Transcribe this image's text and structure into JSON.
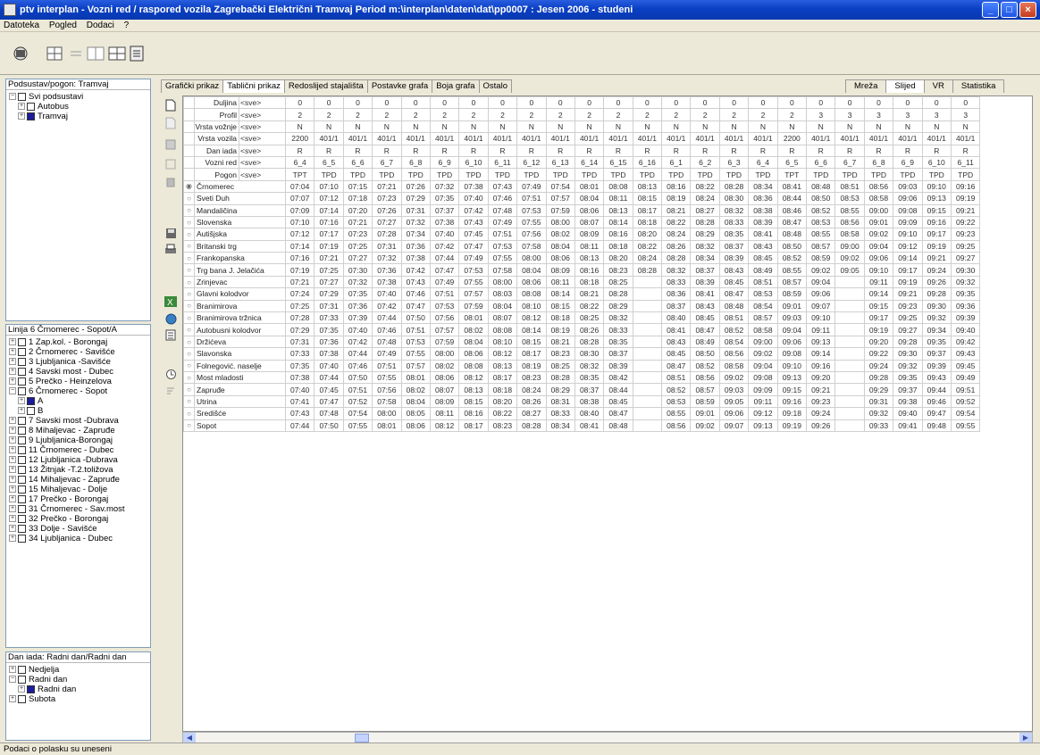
{
  "window": {
    "title": "ptv interplan - Vozni red / raspored vozila  Zagrebački Električni Tramvaj Period m:\\interplan\\daten\\dat\\pp0007 : Jesen 2006 - studeni",
    "buttons": [
      "_",
      "□",
      "×"
    ]
  },
  "menu": [
    "Datoteka",
    "Pogled",
    "Dodaci",
    "?"
  ],
  "panels": {
    "top": {
      "header": "Podsustav/pogon: Tramvaj",
      "nodes": [
        {
          "ex": "−",
          "label": "Svi podsustavi",
          "indent": 0,
          "on": false
        },
        {
          "ex": "+",
          "label": "Autobus",
          "indent": 1,
          "on": false
        },
        {
          "ex": "+",
          "label": "Tramvaj",
          "indent": 1,
          "on": true
        }
      ]
    },
    "mid": {
      "header": "Linija 6 Črnomerec - Sopot/A",
      "nodes": [
        {
          "ex": "+",
          "label": "1 Zap.kol. - Borongaj",
          "indent": 0,
          "on": false
        },
        {
          "ex": "+",
          "label": "2 Črnomerec - Savišće",
          "indent": 0,
          "on": false
        },
        {
          "ex": "+",
          "label": "3 Ljubljanica -Savišće",
          "indent": 0,
          "on": false
        },
        {
          "ex": "+",
          "label": "4 Savski most - Dubec",
          "indent": 0,
          "on": false
        },
        {
          "ex": "+",
          "label": "5 Prečko - Heinzelova",
          "indent": 0,
          "on": false
        },
        {
          "ex": "−",
          "label": "6 Črnomerec - Sopot",
          "indent": 0,
          "on": false
        },
        {
          "ex": "+",
          "label": "A",
          "indent": 1,
          "on": true
        },
        {
          "ex": "+",
          "label": "B",
          "indent": 1,
          "on": false
        },
        {
          "ex": "+",
          "label": "7 Savski most -Dubrava",
          "indent": 0,
          "on": false
        },
        {
          "ex": "+",
          "label": "8 Mihaljevac - Zapruđe",
          "indent": 0,
          "on": false
        },
        {
          "ex": "+",
          "label": "9 Ljubljanica-Borongaj",
          "indent": 0,
          "on": false
        },
        {
          "ex": "+",
          "label": "11 Črnomerec - Dubec",
          "indent": 0,
          "on": false
        },
        {
          "ex": "+",
          "label": "12 Ljubljanica -Dubrava",
          "indent": 0,
          "on": false
        },
        {
          "ex": "+",
          "label": "13 Žitnjak -T.2.toližova",
          "indent": 0,
          "on": false
        },
        {
          "ex": "+",
          "label": "14 Mihaljevac - Zapruđe",
          "indent": 0,
          "on": false
        },
        {
          "ex": "+",
          "label": "15 Mihaljevac - Dolje",
          "indent": 0,
          "on": false
        },
        {
          "ex": "+",
          "label": "17 Prečko - Borongaj",
          "indent": 0,
          "on": false
        },
        {
          "ex": "+",
          "label": "31 Črnomerec - Sav.most",
          "indent": 0,
          "on": false
        },
        {
          "ex": "+",
          "label": "32 Prečko - Borongaj",
          "indent": 0,
          "on": false
        },
        {
          "ex": "+",
          "label": "33 Dolje - Savišće",
          "indent": 0,
          "on": false
        },
        {
          "ex": "+",
          "label": "34 Ljubljanica - Dubec",
          "indent": 0,
          "on": false
        }
      ]
    },
    "bottom": {
      "header": "Dan iada: Radni dan/Radni dan",
      "nodes": [
        {
          "ex": "+",
          "label": "Nedjelja",
          "indent": 0,
          "on": false
        },
        {
          "ex": "−",
          "label": "Radni dan",
          "indent": 0,
          "on": false
        },
        {
          "ex": "+",
          "label": "Radni dan",
          "indent": 1,
          "on": true
        },
        {
          "ex": "+",
          "label": "Subota",
          "indent": 0,
          "on": false
        }
      ]
    }
  },
  "tabs": [
    "Grafički prikaz",
    "Tablični prikaz",
    "Redoslijed stajališta",
    "Postavke grafa",
    "Boja grafa",
    "Ostalo"
  ],
  "active_tab": 1,
  "right_tabs": [
    "Mreža",
    "Slijed",
    "VR",
    "Statistika"
  ],
  "right_active": 1,
  "grid": {
    "header_rows": [
      {
        "label": "Duljina",
        "sel": "<sve>",
        "values": [
          "0",
          "0",
          "0",
          "0",
          "0",
          "0",
          "0",
          "0",
          "0",
          "0",
          "0",
          "0",
          "0",
          "0",
          "0",
          "0",
          "0",
          "0",
          "0",
          "0",
          "0",
          "0",
          "0",
          "0"
        ]
      },
      {
        "label": "Profil",
        "sel": "<sve>",
        "values": [
          "2",
          "2",
          "2",
          "2",
          "2",
          "2",
          "2",
          "2",
          "2",
          "2",
          "2",
          "2",
          "2",
          "2",
          "2",
          "2",
          "2",
          "2",
          "3",
          "3",
          "3",
          "3",
          "3",
          "3"
        ]
      },
      {
        "label": "Vrsta vožnje",
        "sel": "<sve>",
        "values": [
          "N",
          "N",
          "N",
          "N",
          "N",
          "N",
          "N",
          "N",
          "N",
          "N",
          "N",
          "N",
          "N",
          "N",
          "N",
          "N",
          "N",
          "N",
          "N",
          "N",
          "N",
          "N",
          "N",
          "N"
        ]
      },
      {
        "label": "Vrsta vozila",
        "sel": "<sve>",
        "values": [
          "2200",
          "401/1",
          "401/1",
          "401/1",
          "401/1",
          "401/1",
          "401/1",
          "401/1",
          "401/1",
          "401/1",
          "401/1",
          "401/1",
          "401/1",
          "401/1",
          "401/1",
          "401/1",
          "401/1",
          "2200",
          "401/1",
          "401/1",
          "401/1",
          "401/1",
          "401/1",
          "401/1"
        ]
      },
      {
        "label": "Dan iada",
        "sel": "<sve>",
        "values": [
          "R",
          "R",
          "R",
          "R",
          "R",
          "R",
          "R",
          "R",
          "R",
          "R",
          "R",
          "R",
          "R",
          "R",
          "R",
          "R",
          "R",
          "R",
          "R",
          "R",
          "R",
          "R",
          "R",
          "R"
        ]
      },
      {
        "label": "Vozni red",
        "sel": "<sve>",
        "values": [
          "6_4",
          "6_5",
          "6_6",
          "6_7",
          "6_8",
          "6_9",
          "6_10",
          "6_11",
          "6_12",
          "6_13",
          "6_14",
          "6_15",
          "6_16",
          "6_1",
          "6_2",
          "6_3",
          "6_4",
          "6_5",
          "6_6",
          "6_7",
          "6_8",
          "6_9",
          "6_10",
          "6_11"
        ]
      },
      {
        "label": "Pogon",
        "sel": "<sve>",
        "values": [
          "TPT",
          "TPD",
          "TPD",
          "TPD",
          "TPD",
          "TPD",
          "TPD",
          "TPD",
          "TPD",
          "TPD",
          "TPD",
          "TPD",
          "TPD",
          "TPD",
          "TPD",
          "TPD",
          "TPD",
          "TPT",
          "TPD",
          "TPD",
          "TPD",
          "TPD",
          "TPD",
          "TPD"
        ]
      }
    ],
    "stops": [
      {
        "name": "Črnomerec",
        "sel": true,
        "times": [
          "07:04",
          "07:10",
          "07:15",
          "07:21",
          "07:26",
          "07:32",
          "07:38",
          "07:43",
          "07:49",
          "07:54",
          "08:01",
          "08:08",
          "08:13",
          "08:16",
          "08:22",
          "08:28",
          "08:34",
          "08:41",
          "08:48",
          "08:51",
          "08:56",
          "09:03",
          "09:10",
          "09:16"
        ]
      },
      {
        "name": "Sveti Duh",
        "sel": false,
        "times": [
          "07:07",
          "07:12",
          "07:18",
          "07:23",
          "07:29",
          "07:35",
          "07:40",
          "07:46",
          "07:51",
          "07:57",
          "08:04",
          "08:11",
          "08:15",
          "08:19",
          "08:24",
          "08:30",
          "08:36",
          "08:44",
          "08:50",
          "08:53",
          "08:58",
          "09:06",
          "09:13",
          "09:19"
        ]
      },
      {
        "name": "Mandaličina",
        "sel": false,
        "times": [
          "07:09",
          "07:14",
          "07:20",
          "07:26",
          "07:31",
          "07:37",
          "07:42",
          "07:48",
          "07:53",
          "07:59",
          "08:06",
          "08:13",
          "08:17",
          "08:21",
          "08:27",
          "08:32",
          "08:38",
          "08:46",
          "08:52",
          "08:55",
          "09:00",
          "09:08",
          "09:15",
          "09:21"
        ]
      },
      {
        "name": "Slovenska",
        "sel": false,
        "times": [
          "07:10",
          "07:16",
          "07:21",
          "07:27",
          "07:32",
          "07:38",
          "07:43",
          "07:49",
          "07:55",
          "08:00",
          "08:07",
          "08:14",
          "08:18",
          "08:22",
          "08:28",
          "08:33",
          "08:39",
          "08:47",
          "08:53",
          "08:56",
          "09:01",
          "09:09",
          "09:16",
          "09:22"
        ]
      },
      {
        "name": "Autišjska",
        "sel": false,
        "times": [
          "07:12",
          "07:17",
          "07:23",
          "07:28",
          "07:34",
          "07:40",
          "07:45",
          "07:51",
          "07:56",
          "08:02",
          "08:09",
          "08:16",
          "08:20",
          "08:24",
          "08:29",
          "08:35",
          "08:41",
          "08:48",
          "08:55",
          "08:58",
          "09:02",
          "09:10",
          "09:17",
          "09:23"
        ]
      },
      {
        "name": "Britanski trg",
        "sel": false,
        "times": [
          "07:14",
          "07:19",
          "07:25",
          "07:31",
          "07:36",
          "07:42",
          "07:47",
          "07:53",
          "07:58",
          "08:04",
          "08:11",
          "08:18",
          "08:22",
          "08:26",
          "08:32",
          "08:37",
          "08:43",
          "08:50",
          "08:57",
          "09:00",
          "09:04",
          "09:12",
          "09:19",
          "09:25"
        ]
      },
      {
        "name": "Frankopanska",
        "sel": false,
        "times": [
          "07:16",
          "07:21",
          "07:27",
          "07:32",
          "07:38",
          "07:44",
          "07:49",
          "07:55",
          "08:00",
          "08:06",
          "08:13",
          "08:20",
          "08:24",
          "08:28",
          "08:34",
          "08:39",
          "08:45",
          "08:52",
          "08:59",
          "09:02",
          "09:06",
          "09:14",
          "09:21",
          "09:27"
        ]
      },
      {
        "name": "Trg bana J. Jelačića",
        "sel": false,
        "times": [
          "07:19",
          "07:25",
          "07:30",
          "07:36",
          "07:42",
          "07:47",
          "07:53",
          "07:58",
          "08:04",
          "08:09",
          "08:16",
          "08:23",
          "08:28",
          "08:32",
          "08:37",
          "08:43",
          "08:49",
          "08:55",
          "09:02",
          "09:05",
          "09:10",
          "09:17",
          "09:24",
          "09:30"
        ]
      },
      {
        "name": "Zrinjevac",
        "sel": false,
        "times": [
          "07:21",
          "07:27",
          "07:32",
          "07:38",
          "07:43",
          "07:49",
          "07:55",
          "08:00",
          "08:06",
          "08:11",
          "08:18",
          "08:25",
          "",
          "08:33",
          "08:39",
          "08:45",
          "08:51",
          "08:57",
          "09:04",
          "",
          "09:11",
          "09:19",
          "09:26",
          "09:32"
        ]
      },
      {
        "name": "Glavni kolodvor",
        "sel": false,
        "times": [
          "07:24",
          "07:29",
          "07:35",
          "07:40",
          "07:46",
          "07:51",
          "07:57",
          "08:03",
          "08:08",
          "08:14",
          "08:21",
          "08:28",
          "",
          "08:36",
          "08:41",
          "08:47",
          "08:53",
          "08:59",
          "09:06",
          "",
          "09:14",
          "09:21",
          "09:28",
          "09:35"
        ]
      },
      {
        "name": "Branimirova",
        "sel": false,
        "times": [
          "07:25",
          "07:31",
          "07:36",
          "07:42",
          "07:47",
          "07:53",
          "07:59",
          "08:04",
          "08:10",
          "08:15",
          "08:22",
          "08:29",
          "",
          "08:37",
          "08:43",
          "08:48",
          "08:54",
          "09:01",
          "09:07",
          "",
          "09:15",
          "09:23",
          "09:30",
          "09:36"
        ]
      },
      {
        "name": "Branimirova tržnica",
        "sel": false,
        "times": [
          "07:28",
          "07:33",
          "07:39",
          "07:44",
          "07:50",
          "07:56",
          "08:01",
          "08:07",
          "08:12",
          "08:18",
          "08:25",
          "08:32",
          "",
          "08:40",
          "08:45",
          "08:51",
          "08:57",
          "09:03",
          "09:10",
          "",
          "09:17",
          "09:25",
          "09:32",
          "09:39"
        ]
      },
      {
        "name": "Autobusni kolodvor",
        "sel": false,
        "times": [
          "07:29",
          "07:35",
          "07:40",
          "07:46",
          "07:51",
          "07:57",
          "08:02",
          "08:08",
          "08:14",
          "08:19",
          "08:26",
          "08:33",
          "",
          "08:41",
          "08:47",
          "08:52",
          "08:58",
          "09:04",
          "09:11",
          "",
          "09:19",
          "09:27",
          "09:34",
          "09:40"
        ]
      },
      {
        "name": "Držićeva",
        "sel": false,
        "times": [
          "07:31",
          "07:36",
          "07:42",
          "07:48",
          "07:53",
          "07:59",
          "08:04",
          "08:10",
          "08:15",
          "08:21",
          "08:28",
          "08:35",
          "",
          "08:43",
          "08:49",
          "08:54",
          "09:00",
          "09:06",
          "09:13",
          "",
          "09:20",
          "09:28",
          "09:35",
          "09:42"
        ]
      },
      {
        "name": "Slavonska",
        "sel": false,
        "times": [
          "07:33",
          "07:38",
          "07:44",
          "07:49",
          "07:55",
          "08:00",
          "08:06",
          "08:12",
          "08:17",
          "08:23",
          "08:30",
          "08:37",
          "",
          "08:45",
          "08:50",
          "08:56",
          "09:02",
          "09:08",
          "09:14",
          "",
          "09:22",
          "09:30",
          "09:37",
          "09:43"
        ]
      },
      {
        "name": "Folnegović. naselje",
        "sel": false,
        "times": [
          "07:35",
          "07:40",
          "07:46",
          "07:51",
          "07:57",
          "08:02",
          "08:08",
          "08:13",
          "08:19",
          "08:25",
          "08:32",
          "08:39",
          "",
          "08:47",
          "08:52",
          "08:58",
          "09:04",
          "09:10",
          "09:16",
          "",
          "09:24",
          "09:32",
          "09:39",
          "09:45"
        ]
      },
      {
        "name": "Most mladosti",
        "sel": false,
        "times": [
          "07:38",
          "07:44",
          "07:50",
          "07:55",
          "08:01",
          "08:06",
          "08:12",
          "08:17",
          "08:23",
          "08:28",
          "08:35",
          "08:42",
          "",
          "08:51",
          "08:56",
          "09:02",
          "09:08",
          "09:13",
          "09:20",
          "",
          "09:28",
          "09:35",
          "09:43",
          "09:49"
        ]
      },
      {
        "name": "Zapruđe",
        "sel": false,
        "times": [
          "07:40",
          "07:45",
          "07:51",
          "07:56",
          "08:02",
          "08:07",
          "08:13",
          "08:18",
          "08:24",
          "08:29",
          "08:37",
          "08:44",
          "",
          "08:52",
          "08:57",
          "09:03",
          "09:09",
          "09:15",
          "09:21",
          "",
          "09:29",
          "09:37",
          "09:44",
          "09:51"
        ]
      },
      {
        "name": "Utrina",
        "sel": false,
        "times": [
          "07:41",
          "07:47",
          "07:52",
          "07:58",
          "08:04",
          "08:09",
          "08:15",
          "08:20",
          "08:26",
          "08:31",
          "08:38",
          "08:45",
          "",
          "08:53",
          "08:59",
          "09:05",
          "09:11",
          "09:16",
          "09:23",
          "",
          "09:31",
          "09:38",
          "09:46",
          "09:52"
        ]
      },
      {
        "name": "Središće",
        "sel": false,
        "times": [
          "07:43",
          "07:48",
          "07:54",
          "08:00",
          "08:05",
          "08:11",
          "08:16",
          "08:22",
          "08:27",
          "08:33",
          "08:40",
          "08:47",
          "",
          "08:55",
          "09:01",
          "09:06",
          "09:12",
          "09:18",
          "09:24",
          "",
          "09:32",
          "09:40",
          "09:47",
          "09:54"
        ]
      },
      {
        "name": "Sopot",
        "sel": false,
        "times": [
          "07:44",
          "07:50",
          "07:55",
          "08:01",
          "08:06",
          "08:12",
          "08:17",
          "08:23",
          "08:28",
          "08:34",
          "08:41",
          "08:48",
          "",
          "08:56",
          "09:02",
          "09:07",
          "09:13",
          "09:19",
          "09:26",
          "",
          "09:33",
          "09:41",
          "09:48",
          "09:55"
        ]
      }
    ]
  },
  "status": "Podaci o polasku su uneseni"
}
